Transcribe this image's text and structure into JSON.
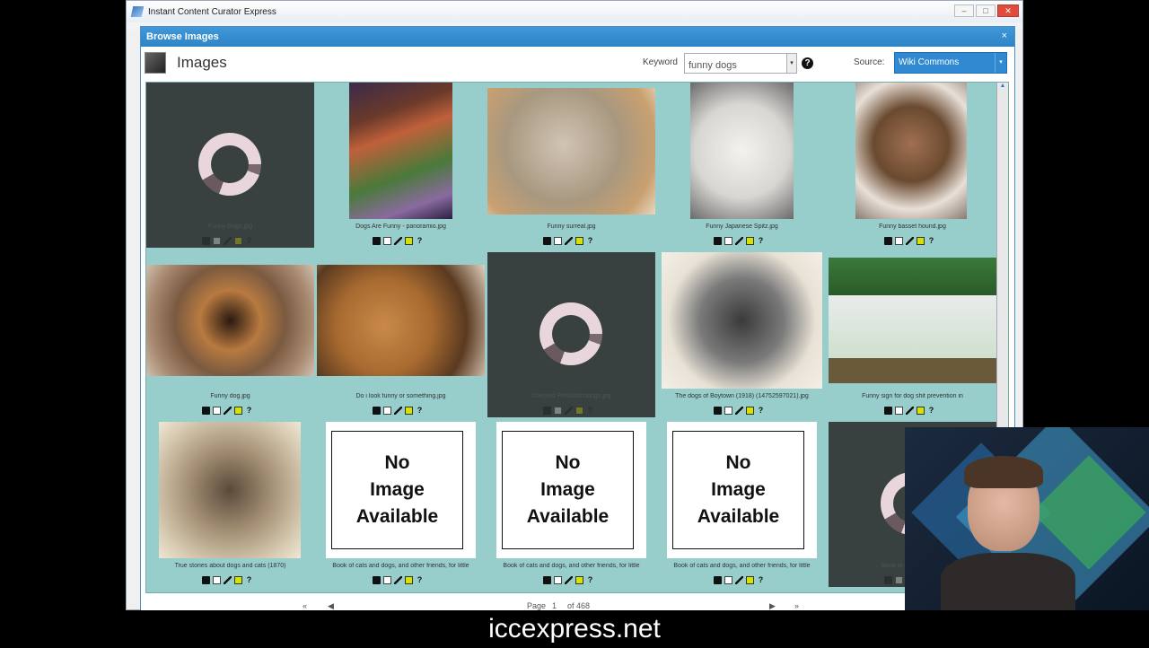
{
  "window": {
    "title": "Instant Content Curator Express",
    "minimize": "–",
    "maximize": "□",
    "close": "✕"
  },
  "dialog": {
    "title": "Browse Images",
    "close": "×",
    "heading": "Images",
    "keyword_label": "Keyword",
    "keyword_value": "funny dogs",
    "help": "?",
    "source_label": "Source:",
    "source_value": "Wiki Commons",
    "dropdown_arrow": "▾"
  },
  "colors": {
    "accent": "#3089d1",
    "gallery_bg": "#97cecb",
    "loading_bg": "#38413f"
  },
  "cards": [
    {
      "caption": "Funny Dogs.jpg",
      "state": "loading"
    },
    {
      "caption": "Dogs Are Funny - panoramio.jpg",
      "state": "image"
    },
    {
      "caption": "Funny surreal.jpg",
      "state": "image"
    },
    {
      "caption": "Funny Japanese Spitz.jpg",
      "state": "image"
    },
    {
      "caption": "Funny basset hound.jpg",
      "state": "image"
    },
    {
      "caption": "Funny dog.jpg",
      "state": "image"
    },
    {
      "caption": "Do i look funny or something.jpg",
      "state": "image"
    },
    {
      "caption": "Dressed PetsWatchdogs.jpg",
      "state": "loading"
    },
    {
      "caption": "The dogs of Boytown (1918) (14752597021).jpg",
      "state": "image"
    },
    {
      "caption": "Funny sign for dog shit prevention in",
      "state": "image"
    },
    {
      "caption": "True stories about dogs and cats (1870)",
      "state": "image"
    },
    {
      "caption": "Book of cats and dogs, and other friends, for little",
      "state": "noimage"
    },
    {
      "caption": "Book of cats and dogs, and other friends, for little",
      "state": "noimage"
    },
    {
      "caption": "Book of cats and dogs, and other friends, for little",
      "state": "noimage"
    },
    {
      "caption": "Book of cats and dogs",
      "state": "loading"
    }
  ],
  "no_image": {
    "line1": "No",
    "line2": "Image",
    "line3": "Available"
  },
  "action_icons": {
    "save": "",
    "copy": "",
    "edit": "",
    "tag": "",
    "help": "?"
  },
  "pager": {
    "first": "«",
    "prev": "◀",
    "page_label": "Page",
    "page_value": "1",
    "of_label": "of 468",
    "next": "▶",
    "last": "»"
  },
  "footer": {
    "text": "iccexpress.net"
  }
}
